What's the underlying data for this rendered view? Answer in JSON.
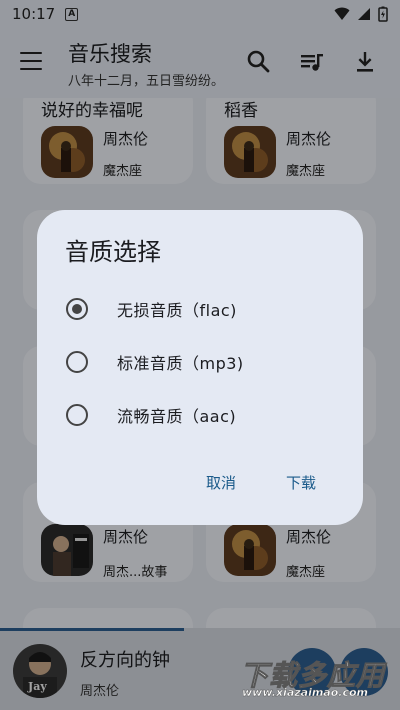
{
  "status_bar": {
    "time": "10:17",
    "notif_glyph": "A"
  },
  "app_bar": {
    "title": "音乐搜索",
    "subtitle": "八年十二月，五日雪纷纷。"
  },
  "cards": [
    {
      "song": "说好的幸福呢",
      "artist": "周杰伦",
      "album": "魔杰座"
    },
    {
      "song": "稻香",
      "artist": "周杰伦",
      "album": "魔杰座"
    },
    {
      "song": "",
      "artist": "周杰伦",
      "album": "周杰...故事"
    },
    {
      "song": "",
      "artist": "周杰伦",
      "album": "魔杰座"
    }
  ],
  "dialog": {
    "title": "音质选择",
    "options": [
      {
        "label": "无损音质（flac)",
        "selected": true
      },
      {
        "label": "标准音质（mp3)",
        "selected": false
      },
      {
        "label": "流畅音质（aac)",
        "selected": false
      }
    ],
    "cancel_label": "取消",
    "download_label": "下载"
  },
  "now_playing": {
    "title": "反方向的钟",
    "artist": "周杰伦",
    "cover_text": "Jay",
    "progress": 0.46
  },
  "watermark": {
    "line1": "下载多应用",
    "line2": "www.xiazaimao.com"
  },
  "colors": {
    "accent": "#2b5c8d",
    "dialog_bg": "#e4e9f3",
    "button_text": "#1a5a8a"
  }
}
